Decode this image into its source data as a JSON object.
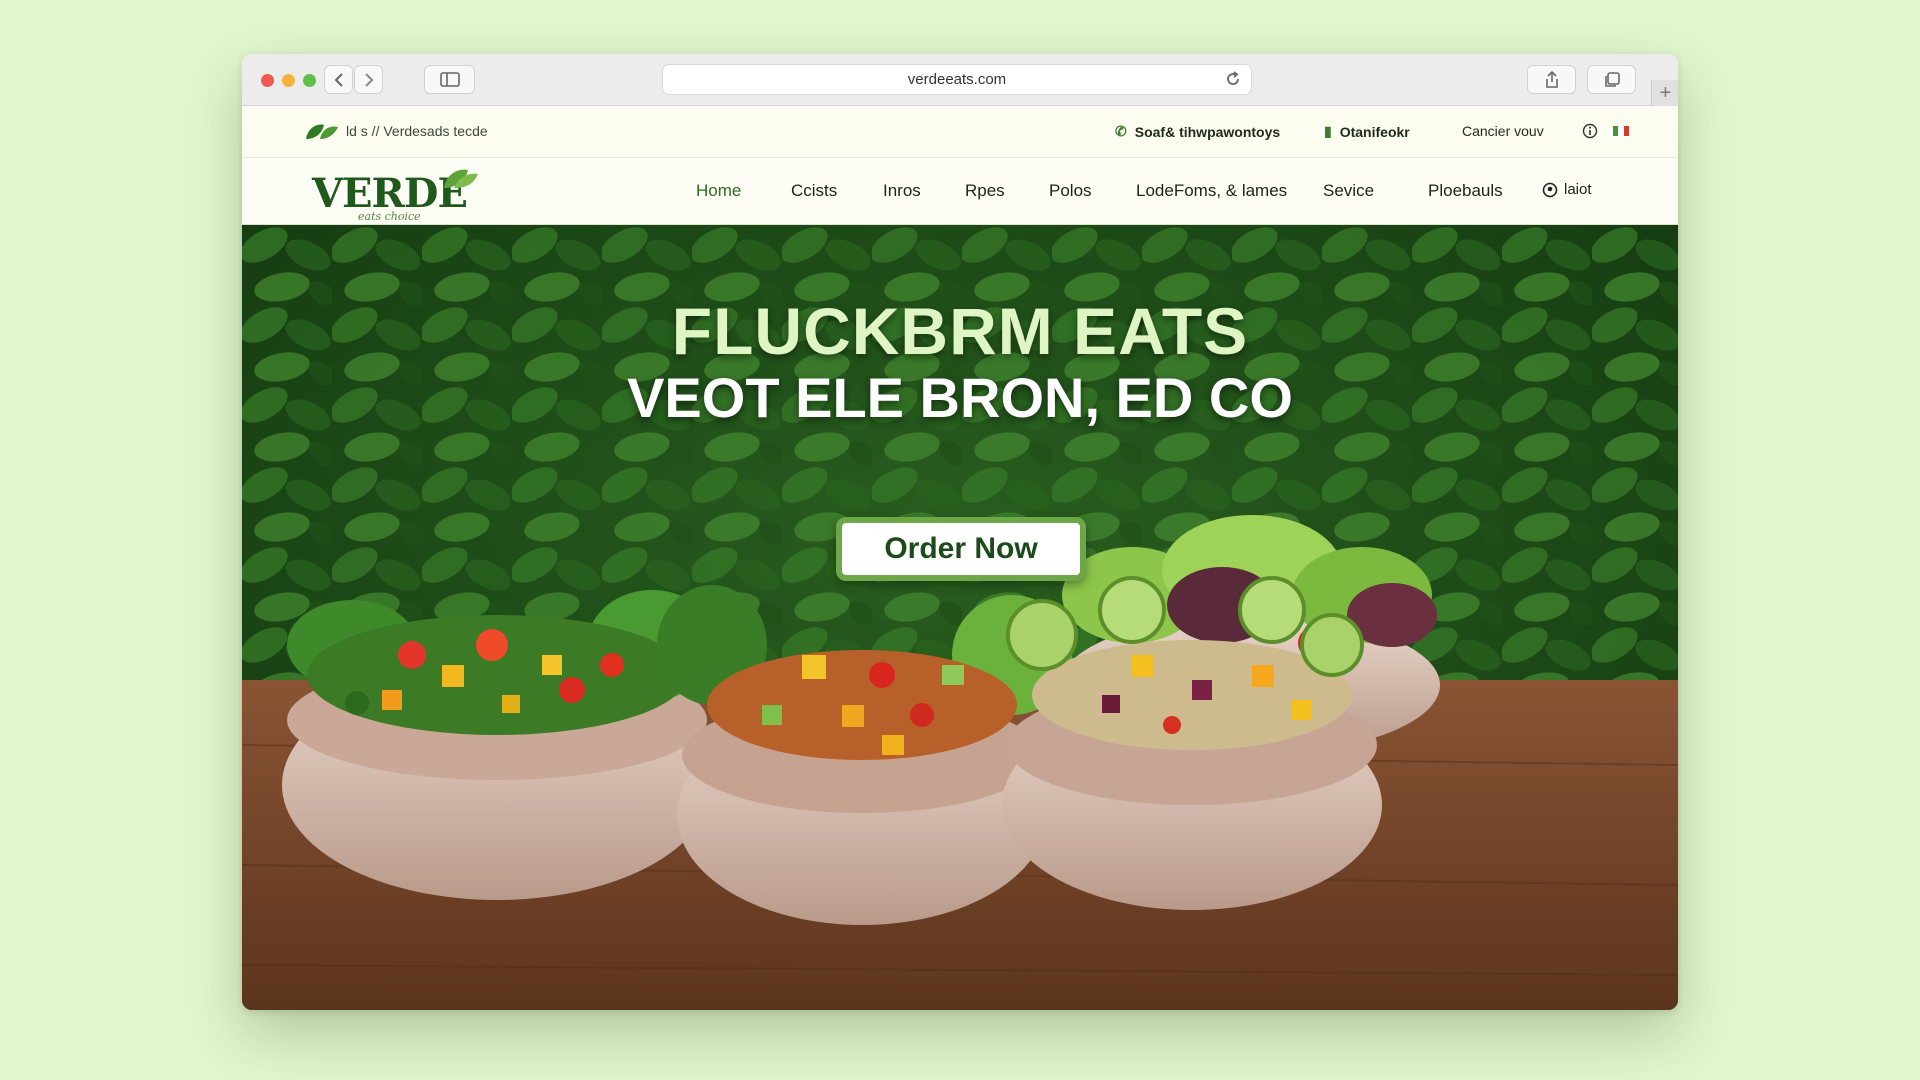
{
  "browser": {
    "url": "verdeeats.com"
  },
  "topbar": {
    "tagline": "ld s // Verdesads tecde",
    "contact": "Soaf& tihwpawontoys",
    "item2": "Otanifeokr",
    "item3": "Cancier vouv"
  },
  "brand": {
    "name": "VERDE",
    "subtitle": "eats choice"
  },
  "nav": {
    "items": [
      "Home",
      "Ccists",
      "Inros",
      "Rpes",
      "Polos",
      "LodeFoms, & lames",
      "Sevice",
      "Ploebauls",
      "laiot"
    ]
  },
  "hero": {
    "title_line1": "FLUCKBRM EATS",
    "title_line2": "VEOT ELE BRON, ED CO",
    "cta": "Order Now"
  },
  "colors": {
    "accent": "#6ea747",
    "brand_dark": "#1f5a1c",
    "page_bg": "#e2f6d0"
  }
}
